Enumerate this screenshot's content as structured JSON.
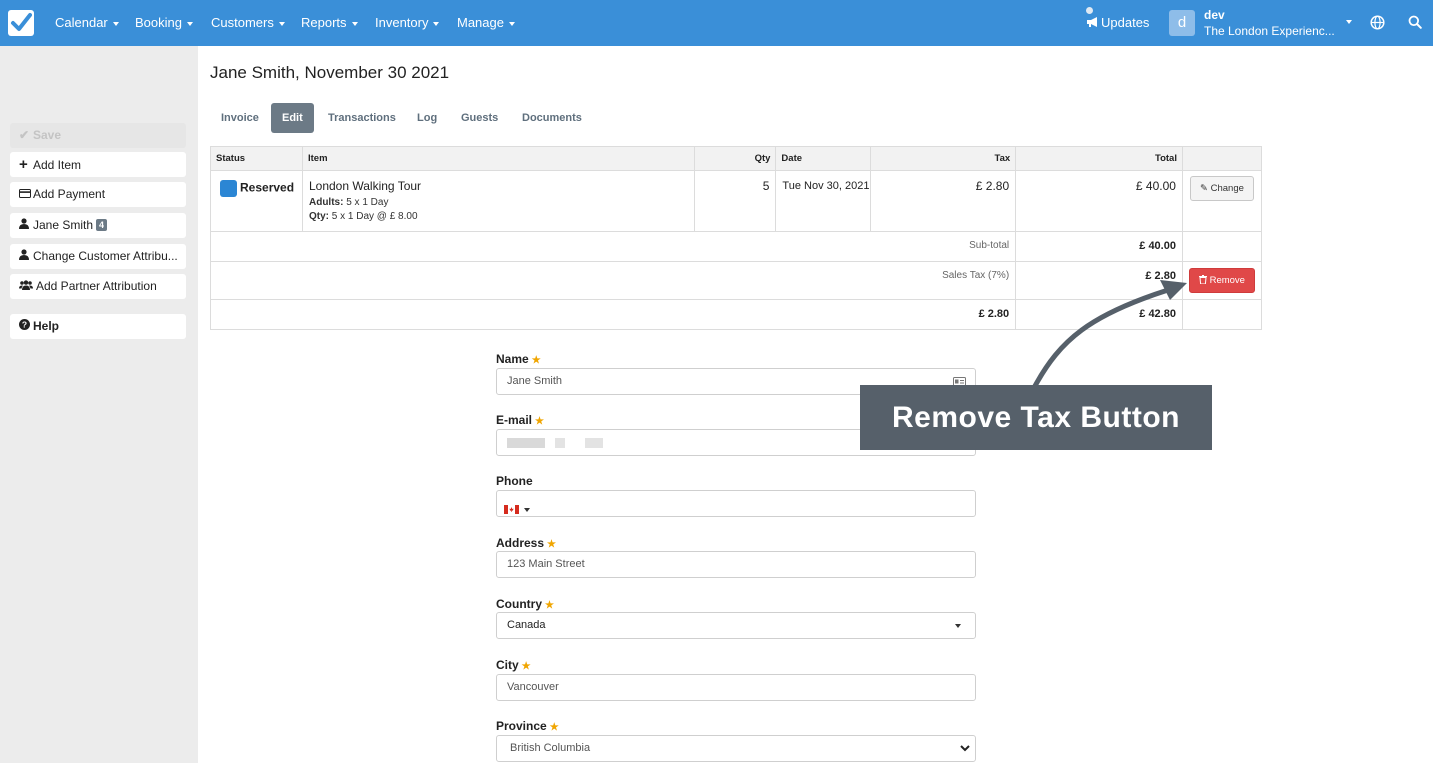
{
  "nav": {
    "items": [
      "Calendar",
      "Booking",
      "Customers",
      "Reports",
      "Inventory",
      "Manage"
    ],
    "updates": "Updates",
    "user_initial": "d",
    "user_name": "dev",
    "company": "The London Experienc...",
    "brand_color": "#3a8fd8"
  },
  "sidebar": {
    "save": "Save",
    "add_item": "Add Item",
    "add_payment": "Add Payment",
    "customer": "Jane Smith",
    "customer_badge": "4",
    "change_attr": "Change Customer Attribu...",
    "partner_attr": "Add Partner Attribution",
    "help": "Help"
  },
  "page": {
    "title": "Jane Smith, November 30 2021"
  },
  "tabs": [
    "Invoice",
    "Edit",
    "Transactions",
    "Log",
    "Guests",
    "Documents"
  ],
  "table": {
    "headers": {
      "status": "Status",
      "item": "Item",
      "qty": "Qty",
      "date": "Date",
      "tax": "Tax",
      "total": "Total"
    },
    "row": {
      "status": "Reserved",
      "item_name": "London Walking Tour",
      "adults_label": "Adults:",
      "adults_value": "5 x 1 Day",
      "qty_label": "Qty:",
      "qty_detail": "5 x 1 Day @ £ 8.00",
      "qty": "5",
      "date": "Tue Nov 30, 2021",
      "tax": "£ 2.80",
      "total": "£ 40.00",
      "change_btn": "Change"
    },
    "subtotal_label": "Sub-total",
    "subtotal": "£ 40.00",
    "sales_tax_label": "Sales Tax (7%)",
    "sales_tax": "£ 2.80",
    "remove_btn": "Remove",
    "tax_total": "£ 2.80",
    "grand_total": "£ 42.80"
  },
  "form": {
    "name_label": "Name",
    "name_value": "Jane Smith",
    "email_label": "E-mail",
    "phone_label": "Phone",
    "address_label": "Address",
    "address_value": "123 Main Street",
    "country_label": "Country",
    "country_value": "Canada",
    "city_label": "City",
    "city_value": "Vancouver",
    "province_label": "Province",
    "province_value": "British Columbia"
  },
  "callout": {
    "text": "Remove Tax Button"
  }
}
